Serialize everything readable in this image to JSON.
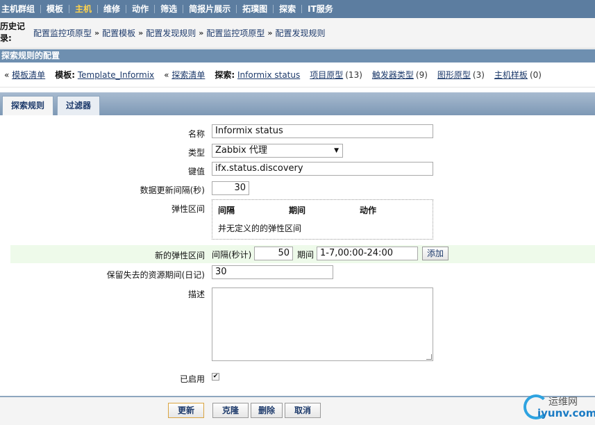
{
  "topnav": {
    "items": [
      {
        "label": "主机群组"
      },
      {
        "label": "模板"
      },
      {
        "label": "主机",
        "active": true
      },
      {
        "label": "维修"
      },
      {
        "label": "动作"
      },
      {
        "label": "筛选"
      },
      {
        "label": "简报片展示"
      },
      {
        "label": "拓璞图"
      },
      {
        "label": "探索"
      },
      {
        "label": "IT服务"
      }
    ],
    "active_color": "#ffd34d"
  },
  "history": {
    "label": "历史记录:",
    "items": [
      "配置监控项原型",
      "配置模板",
      "配置发现规则",
      "配置监控项原型",
      "配置发现规则"
    ],
    "separator": "»"
  },
  "section_header": "探索规则的配置",
  "infobar": {
    "template_list_link": "模板清单",
    "template_label": "模板:",
    "template_name": "Template_Informix",
    "discovery_list_link": "探索清单",
    "discovery_label": "探索:",
    "discovery_name": "Informix status",
    "item_prototypes": {
      "label": "项目原型",
      "count": "(13)"
    },
    "trigger_prototypes": {
      "label": "触发器类型",
      "count": "(9)"
    },
    "graph_prototypes": {
      "label": "图形原型",
      "count": "(3)"
    },
    "host_prototypes": {
      "label": "主机样板",
      "count": "(0)"
    },
    "back_marker": "«"
  },
  "tabs": {
    "discovery_rule": "探索规则",
    "filters": "过滤器"
  },
  "form": {
    "name_label": "名称",
    "name_value": "Informix status",
    "type_label": "类型",
    "type_value": "Zabbix 代理",
    "key_label": "键值",
    "key_value": "ifx.status.discovery",
    "interval_label": "数据更新间隔(秒)",
    "interval_value": "30",
    "flex_label": "弹性区间",
    "flex_headers": {
      "interval": "间隔",
      "period": "期间",
      "action": "动作"
    },
    "flex_empty": "并无定义的的弹性区间",
    "new_flex_label": "新的弹性区间",
    "new_flex_interval_label": "间隔(秒计)",
    "new_flex_interval_value": "50",
    "new_flex_period_label": "期间",
    "new_flex_period_value": "1-7,00:00-24:00",
    "add_button": "添加",
    "lifetime_label": "保留失去的资源期间(日记)",
    "lifetime_value": "30",
    "description_label": "描述",
    "description_value": "",
    "enabled_label": "已启用",
    "enabled": true
  },
  "footer": {
    "update": "更新",
    "clone": "克隆",
    "delete": "删除",
    "cancel": "取消"
  },
  "watermark": {
    "cn": "运维网",
    "en": "iyunv.com"
  }
}
